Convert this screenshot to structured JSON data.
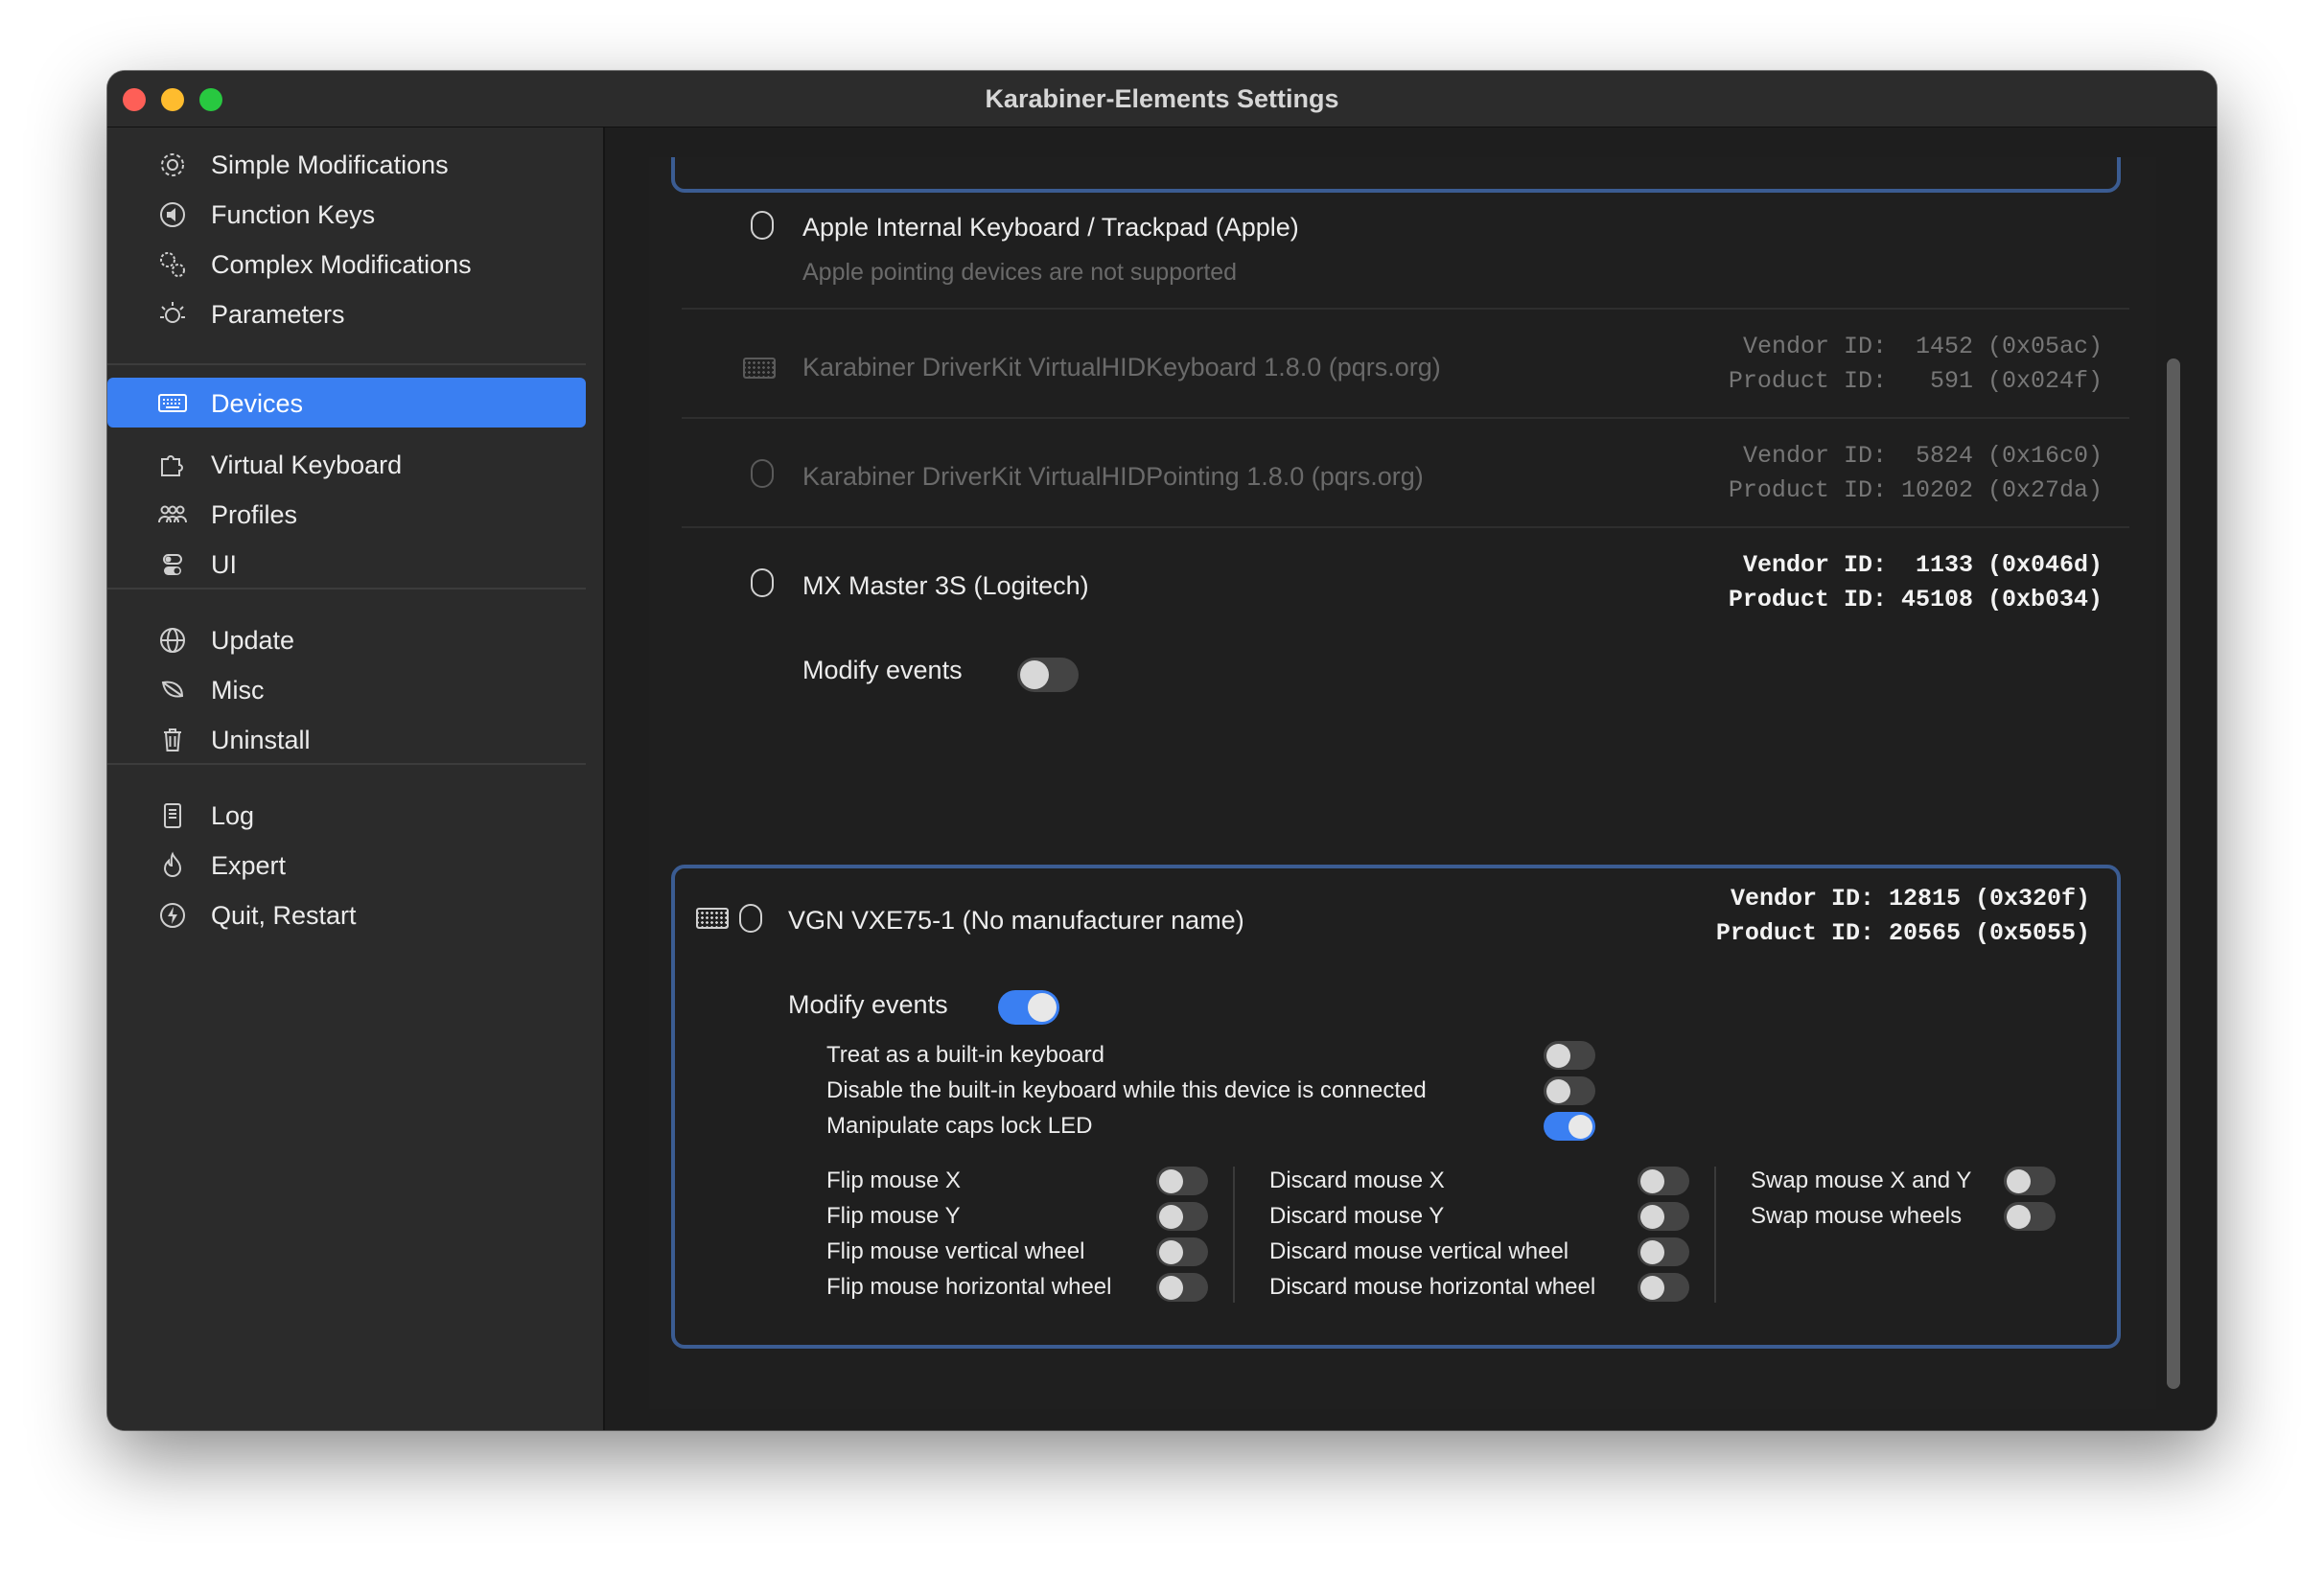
{
  "window": {
    "title": "Karabiner-Elements Settings"
  },
  "sidebar": {
    "items": [
      {
        "label": "Simple Modifications",
        "icon": "gear-icon"
      },
      {
        "label": "Function Keys",
        "icon": "speaker-icon"
      },
      {
        "label": "Complex Modifications",
        "icon": "gears-icon"
      },
      {
        "label": "Parameters",
        "icon": "sun-icon"
      },
      {
        "label": "Devices",
        "icon": "keyboard-icon",
        "active": true
      },
      {
        "label": "Virtual Keyboard",
        "icon": "puzzle-icon"
      },
      {
        "label": "Profiles",
        "icon": "people-icon"
      },
      {
        "label": "UI",
        "icon": "toggles-icon"
      },
      {
        "label": "Update",
        "icon": "globe-icon"
      },
      {
        "label": "Misc",
        "icon": "leaf-icon"
      },
      {
        "label": "Uninstall",
        "icon": "trash-icon"
      },
      {
        "label": "Log",
        "icon": "document-icon"
      },
      {
        "label": "Expert",
        "icon": "flame-icon"
      },
      {
        "label": "Quit, Restart",
        "icon": "power-icon"
      }
    ]
  },
  "devices": {
    "apple": {
      "name": "Apple Internal Keyboard / Trackpad (Apple)",
      "note": "Apple pointing devices are not supported"
    },
    "vhid_keyboard": {
      "name": "Karabiner DriverKit VirtualHIDKeyboard 1.8.0 (pqrs.org)",
      "vendor": "Vendor ID:  1452 (0x05ac)",
      "product": "Product ID:   591 (0x024f)"
    },
    "vhid_pointing": {
      "name": "Karabiner DriverKit VirtualHIDPointing 1.8.0 (pqrs.org)",
      "vendor": "Vendor ID:  5824 (0x16c0)",
      "product": "Product ID: 10202 (0x27da)"
    },
    "mx_master": {
      "name": "MX Master 3S (Logitech)",
      "vendor": "Vendor ID:  1133 (0x046d)",
      "product": "Product ID: 45108 (0xb034)",
      "modify_label": "Modify events",
      "modify_on": false
    },
    "vgn": {
      "name": "VGN VXE75-1 (No manufacturer name)",
      "vendor": "Vendor ID: 12815 (0x320f)",
      "product": "Product ID: 20565 (0x5055)",
      "modify_label": "Modify events",
      "modify_on": true,
      "options": {
        "builtin": "Treat as a built-in keyboard",
        "disable_builtin": "Disable the built-in keyboard while this device is connected",
        "caps_led": "Manipulate caps lock LED",
        "flip_x": "Flip mouse X",
        "flip_y": "Flip mouse Y",
        "flip_vwheel": "Flip mouse vertical wheel",
        "flip_hwheel": "Flip mouse horizontal wheel",
        "discard_x": "Discard mouse X",
        "discard_y": "Discard mouse Y",
        "discard_vwheel": "Discard mouse vertical wheel",
        "discard_hwheel": "Discard mouse horizontal wheel",
        "swap_xy": "Swap mouse X and Y",
        "swap_wheels": "Swap mouse wheels"
      },
      "option_states": {
        "builtin": false,
        "disable_builtin": false,
        "caps_led": true,
        "flip_x": false,
        "flip_y": false,
        "flip_vwheel": false,
        "flip_hwheel": false,
        "discard_x": false,
        "discard_y": false,
        "discard_vwheel": false,
        "discard_hwheel": false,
        "swap_xy": false,
        "swap_wheels": false
      }
    }
  },
  "colors": {
    "accent": "#3a7ff2",
    "selection_border": "#3b5c92"
  }
}
